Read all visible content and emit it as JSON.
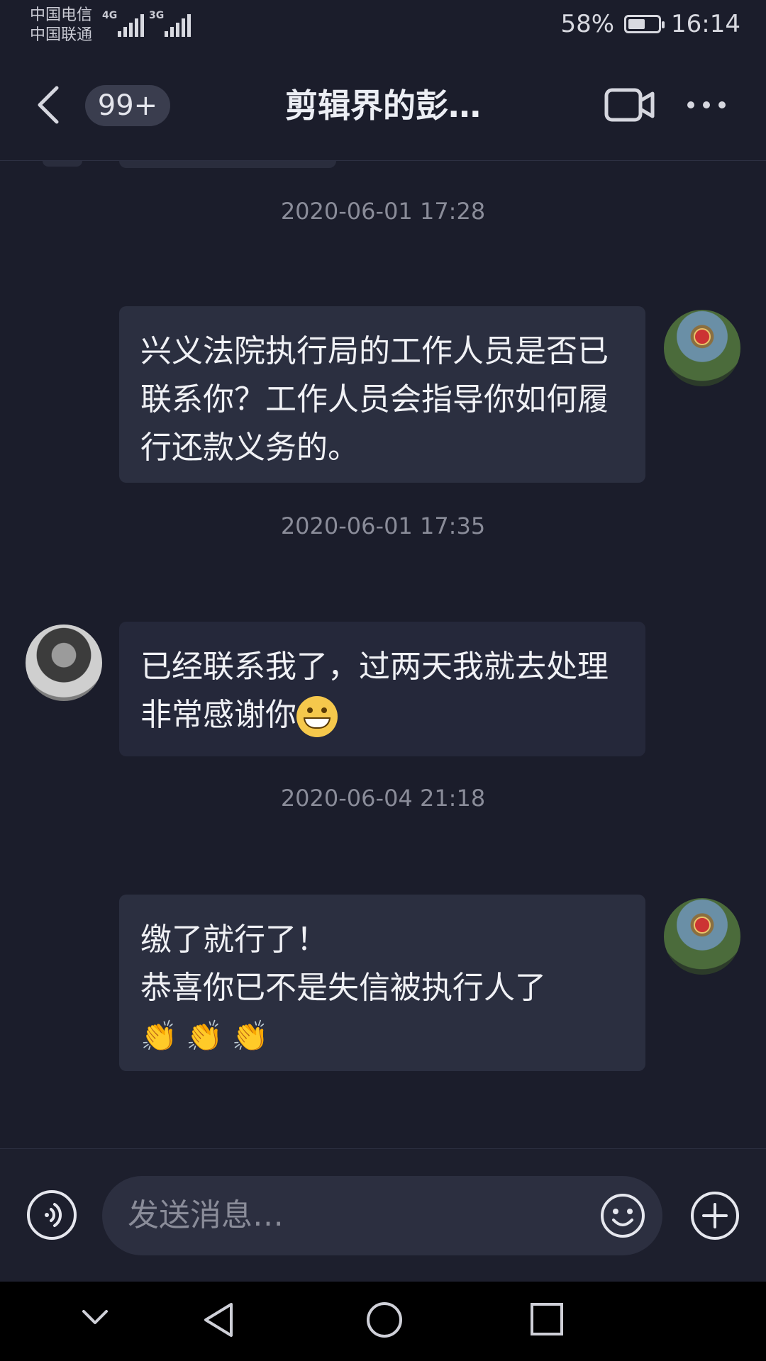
{
  "status_bar": {
    "carrier1": "中国电信",
    "carrier2": "中国联通",
    "network1": "4G",
    "network2": "3G",
    "battery_percent": "58%",
    "battery_level": 0.58,
    "time": "16:14"
  },
  "header": {
    "unread_count": "99+",
    "title": "剪辑界的彭…"
  },
  "messages": [
    {
      "timestamp": "2020-06-01 17:28",
      "side": "right",
      "avatar": "court-avatar",
      "text": "兴义法院执行局的工作人员是否已联系你？工作人员会指导你如何履行还款义务的。"
    },
    {
      "timestamp": "2020-06-01 17:35",
      "side": "left",
      "avatar": "user-avatar",
      "text": "已经联系我了，过两天我就去处理  非常感谢你",
      "emoji": "grin-emoji"
    },
    {
      "timestamp": "2020-06-04 21:18",
      "side": "right",
      "avatar": "court-avatar",
      "line1": "缴了就行了！",
      "line2": "恭喜你已不是失信被执行人了",
      "emoji": "clapping-hands-emoji",
      "emoji_count": 3
    }
  ],
  "input_bar": {
    "placeholder": "发送消息…"
  },
  "icons": {
    "back": "back-icon",
    "video": "video-call-icon",
    "more": "more-icon",
    "voice": "voice-icon",
    "emoji": "emoji-icon",
    "plus": "add-icon"
  },
  "colors": {
    "background": "#1b1d2b",
    "bubble": "#2b2f40",
    "timestamp": "#8a8c99"
  }
}
